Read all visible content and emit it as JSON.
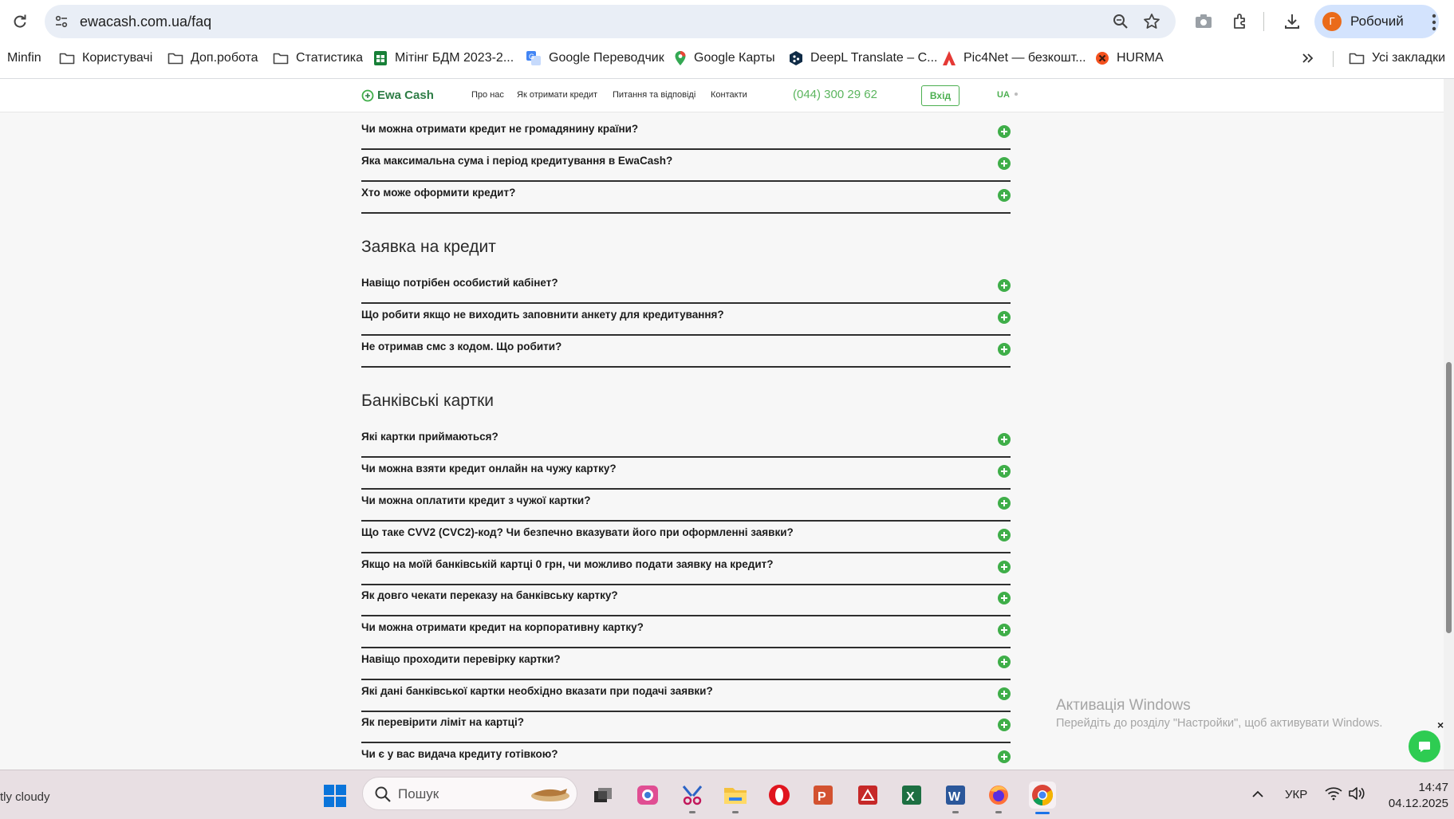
{
  "browser": {
    "url": "ewacash.com.ua/faq",
    "profile_initial": "Г",
    "profile_name": "Робочий",
    "bookmarks": [
      {
        "label": "Minfin",
        "icon": "none"
      },
      {
        "label": "Користувачі",
        "icon": "folder-icon"
      },
      {
        "label": "Доп.робота",
        "icon": "folder-icon"
      },
      {
        "label": "Статистика",
        "icon": "folder-icon"
      },
      {
        "label": "Мітінг БДМ 2023-2...",
        "icon": "sheets-icon"
      },
      {
        "label": "Google Переводчик",
        "icon": "translate-icon"
      },
      {
        "label": "Google Карты",
        "icon": "maps-pin-icon"
      },
      {
        "label": "DeepL Translate – C...",
        "icon": "deepl-icon"
      },
      {
        "label": "Pic4Net — безкошт...",
        "icon": "pic4net-icon"
      },
      {
        "label": "HURMA",
        "icon": "hurma-icon"
      }
    ],
    "all_bookmarks": "Усі закладки"
  },
  "site": {
    "logo": "Ewa Cash",
    "nav": [
      "Про нас",
      "Як отримати кредит",
      "Питання та відповіді",
      "Контакти"
    ],
    "phone": "(044) 300 29 62",
    "login": "Вхід",
    "lang": "UA"
  },
  "faq": {
    "top_questions": [
      "Чи можна отримати кредит не громадянину країни?",
      "Яка максимальна сума і період кредитування в EwaCash?",
      "Хто може оформити кредит?"
    ],
    "section_application": {
      "title": "Заявка на кредит",
      "questions": [
        "Навіщо потрібен особистий кабінет?",
        "Що робити якщо не виходить заповнити анкету для кредитування?",
        "Не отримав смс з кодом. Що робити?"
      ]
    },
    "section_cards": {
      "title": "Банківські картки",
      "questions": [
        "Які картки приймаються?",
        "Чи можна взяти кредит онлайн на чужу картку?",
        "Чи можна оплатити кредит з чужої картки?",
        "Що таке CVV2 (CVC2)-код? Чи безпечно вказувати його при оформленні заявки?",
        "Якщо на моїй банківській картці 0 грн, чи можливо подати заявку на кредит?",
        "Як довго чекати переказу на банківську картку?",
        "Чи можна отримати кредит на корпоративну картку?",
        "Навіщо проходити перевірку картки?",
        "Які дані банківської картки необхідно вказати при подачі заявки?",
        "Як перевірити ліміт на картці?",
        "Чи є у вас видача кредиту готівкою?"
      ]
    }
  },
  "watermark": {
    "title": "Активація Windows",
    "subtitle": "Перейдіть до розділу \"Настройки\", щоб активувати Windows."
  },
  "chat_close": "×",
  "taskbar": {
    "weather": "tly cloudy",
    "search_placeholder": "Пошук",
    "keyboard_lang": "УКР",
    "time": "14:47",
    "date": "04.12.2025"
  },
  "colors": {
    "accent_green": "#3fae49",
    "logo_green": "#2e7d46",
    "profile_orange": "#ea6b1a"
  }
}
